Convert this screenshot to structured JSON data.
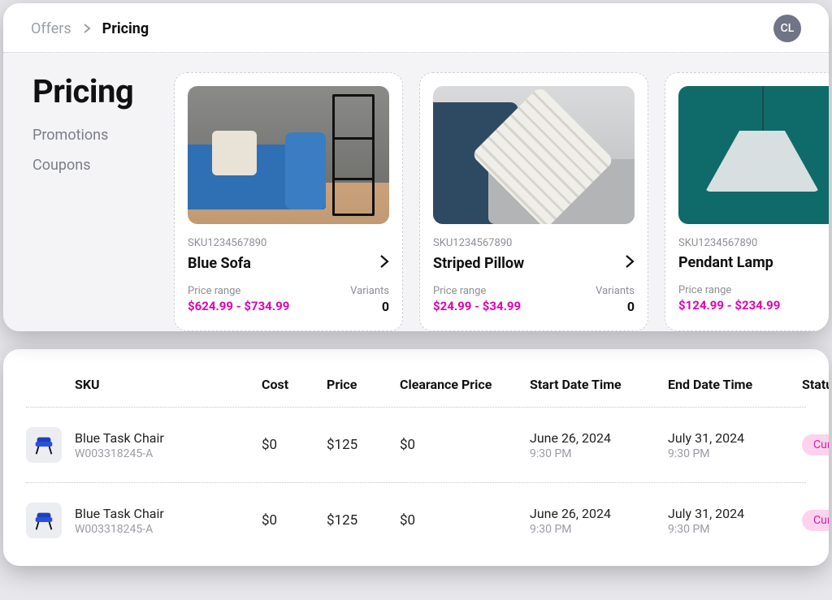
{
  "breadcrumb": {
    "parent": "Offers",
    "current": "Pricing"
  },
  "avatar": "CL",
  "sidebar": {
    "title": "Pricing",
    "links": [
      "Promotions",
      "Coupons"
    ]
  },
  "labels": {
    "price_range": "Price range",
    "variants": "Variants"
  },
  "products": [
    {
      "sku": "SKU1234567890",
      "name": "Blue Sofa",
      "price_range": "$624.99 - $734.99",
      "variants": "0"
    },
    {
      "sku": "SKU1234567890",
      "name": "Striped Pillow",
      "price_range": "$24.99 - $34.99",
      "variants": "0"
    },
    {
      "sku": "SKU1234567890",
      "name": "Pendant Lamp",
      "price_range": "$124.99 - $234.99",
      "variants": ""
    }
  ],
  "table": {
    "headers": {
      "sku": "SKU",
      "cost": "Cost",
      "price": "Price",
      "clearance": "Clearance Price",
      "start": "Start Date Time",
      "end": "End Date Time",
      "status": "Status"
    },
    "rows": [
      {
        "name": "Blue Task Chair",
        "sku": "W003318245-A",
        "cost": "$0",
        "price": "$125",
        "clearance": "$0",
        "start_date": "June 26, 2024",
        "start_time": "9:30 PM",
        "end_date": "July 31, 2024",
        "end_time": "9:30 PM",
        "status": "Current"
      },
      {
        "name": "Blue Task Chair",
        "sku": "W003318245-A",
        "cost": "$0",
        "price": "$125",
        "clearance": "$0",
        "start_date": "June 26, 2024",
        "start_time": "9:30 PM",
        "end_date": "July 31, 2024",
        "end_time": "9:30 PM",
        "status": "Current"
      }
    ]
  }
}
